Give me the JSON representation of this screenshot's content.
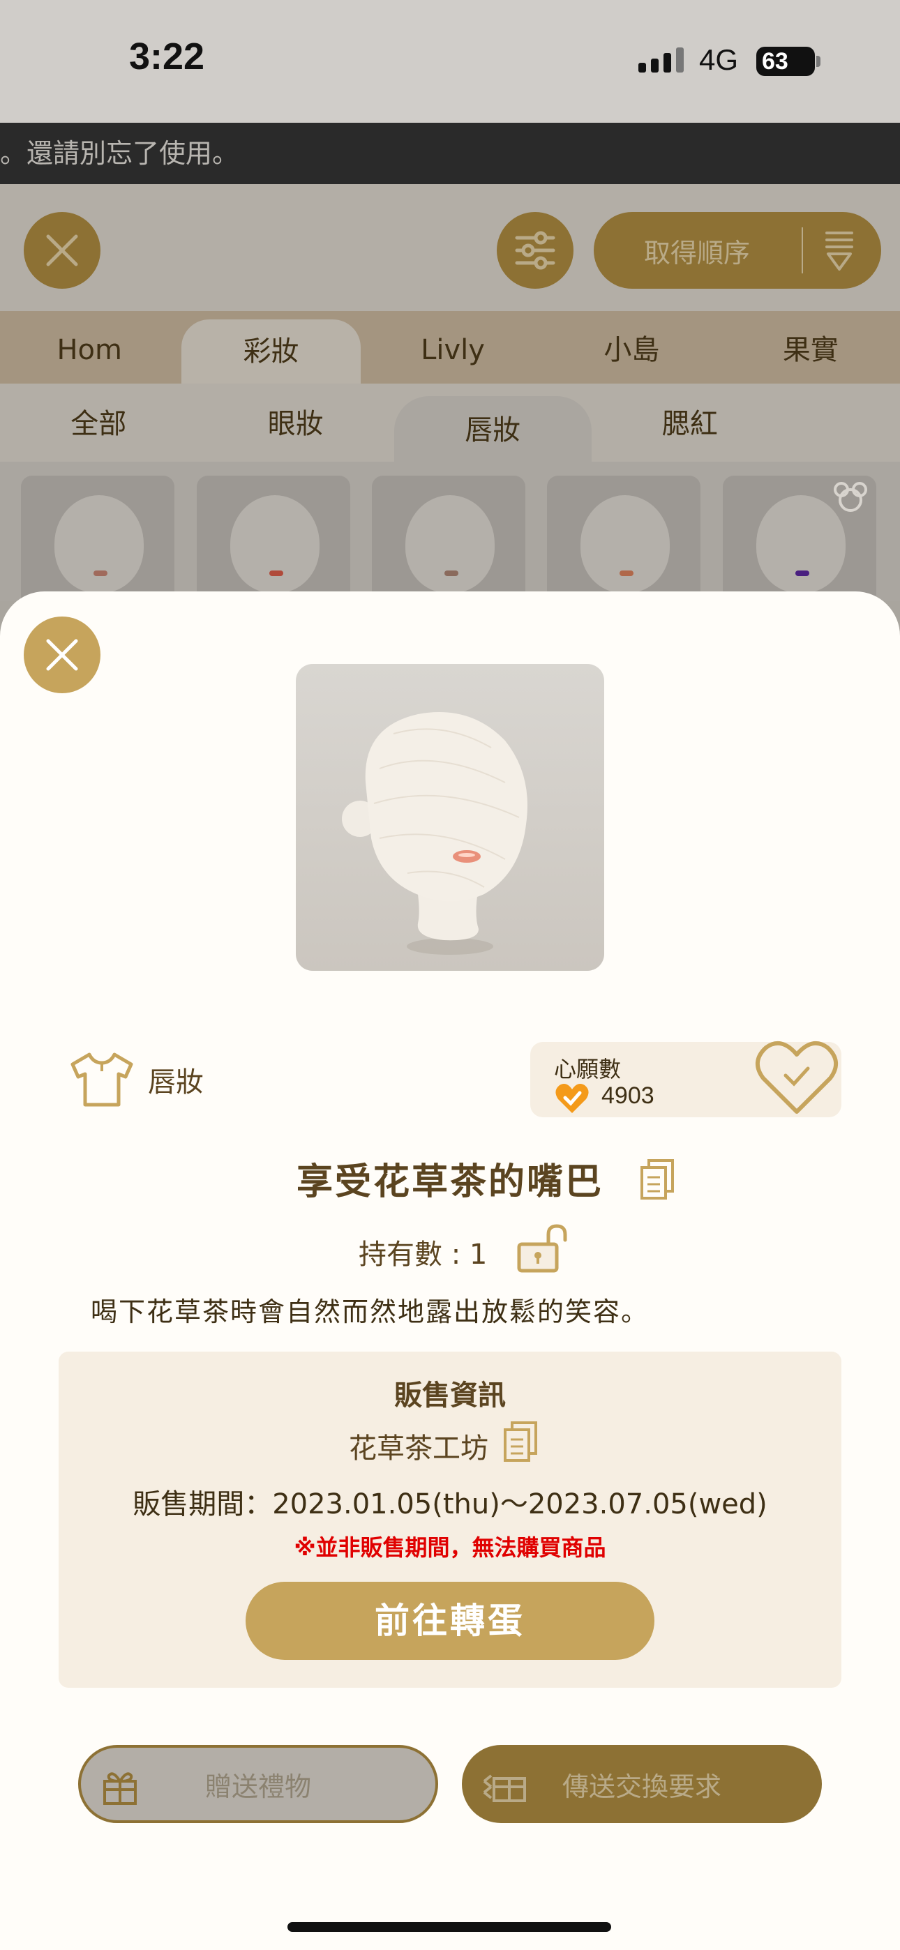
{
  "status_bar": {
    "time": "3:22",
    "network": "4G",
    "battery": "63"
  },
  "notice": {
    "text": "。還請別忘了使用。"
  },
  "toolbar": {
    "order_label": "取得順序"
  },
  "main_tabs": [
    {
      "label": "Hom"
    },
    {
      "label": "彩妝",
      "active": true
    },
    {
      "label": "Livly"
    },
    {
      "label": "小島"
    },
    {
      "label": "果實"
    }
  ],
  "sub_tabs": [
    {
      "label": "全部"
    },
    {
      "label": "眼妝"
    },
    {
      "label": "唇妝",
      "active": true
    },
    {
      "label": "腮紅"
    }
  ],
  "item": {
    "category": "唇妝",
    "name": "享受花草茶的嘴巴",
    "owned": "持有數 : 1",
    "description": "喝下花草茶時會自然而然地露出放鬆的笑容。"
  },
  "wish": {
    "title": "心願數",
    "count": "4903"
  },
  "sales": {
    "title": "販售資訊",
    "shop": "花草茶工坊",
    "period": "販售期間：2023.01.05(thu)～2023.07.05(wed)",
    "warning": "※並非販售期間，無法購買商品",
    "gacha_button": "前往轉蛋"
  },
  "actions": {
    "gift": "贈送禮物",
    "trade": "傳送交換要求"
  },
  "colors": {
    "accent": "#c6a45c",
    "brown": "#5b4420",
    "warning": "#e00000",
    "panel": "#f6eee2"
  }
}
